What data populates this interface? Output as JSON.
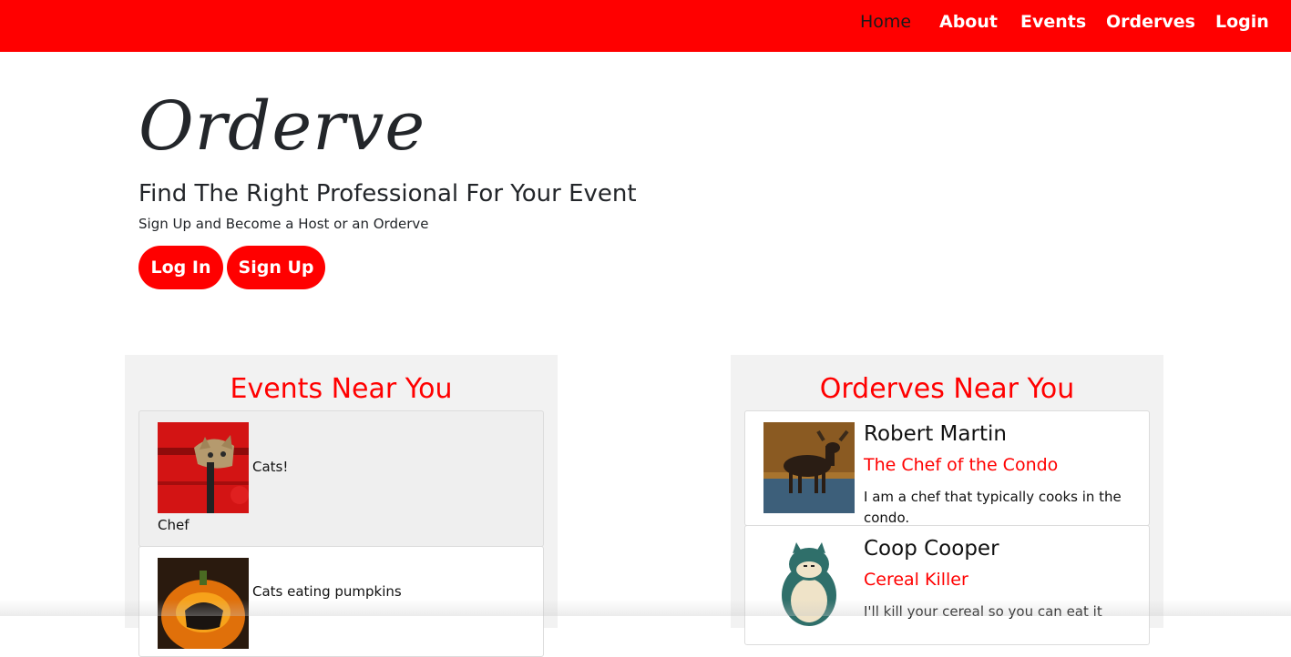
{
  "nav": {
    "items": [
      {
        "label": "Home",
        "active": true
      },
      {
        "label": "About",
        "active": false
      },
      {
        "label": "Events",
        "active": false
      },
      {
        "label": "Orderves",
        "active": false
      },
      {
        "label": "Login",
        "active": false
      }
    ]
  },
  "hero": {
    "title": "Orderve",
    "subtitle": "Find The Right Professional For Your Event",
    "text": "Sign Up and Become a Host or an Orderve",
    "login_label": "Log In",
    "signup_label": "Sign Up"
  },
  "events": {
    "heading": "Events Near You",
    "items": [
      {
        "title": "Cats!",
        "type": "Chef",
        "image": "cat-in-red-suitcase"
      },
      {
        "title": "Cats eating pumpkins",
        "image": "cat-in-pumpkin"
      }
    ]
  },
  "orderves": {
    "heading": "Orderves Near You",
    "items": [
      {
        "name": "Robert Martin",
        "tagline": "The Chef of the Condo",
        "bio": "I am a chef that typically cooks in the condo.",
        "image": "moose-in-lake"
      },
      {
        "name": "Coop Cooper",
        "tagline": "Cereal Killer",
        "bio": "I'll kill your cereal so you can eat it",
        "image": "snorlax"
      }
    ]
  },
  "colors": {
    "brand": "#ff0000",
    "panel": "#f2f2f2"
  }
}
